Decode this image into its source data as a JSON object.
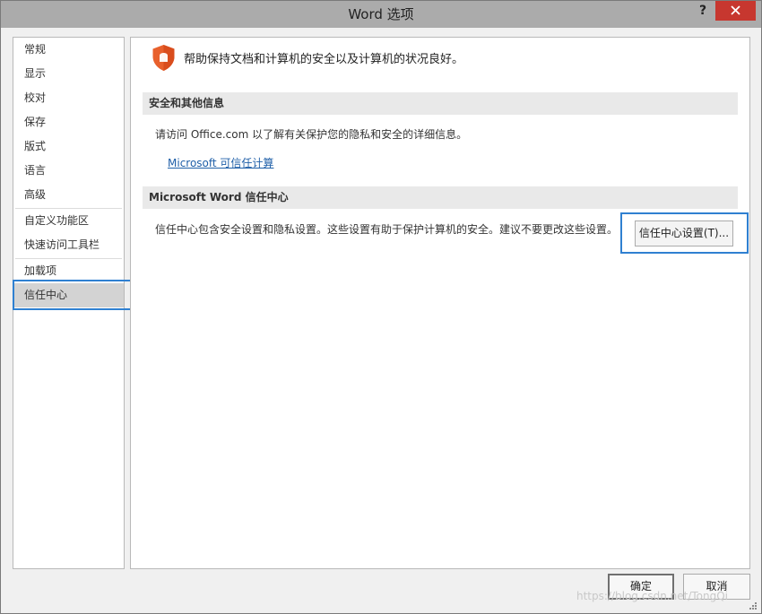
{
  "window": {
    "title": "Word 选项",
    "help_label": "?"
  },
  "nav": {
    "items": [
      {
        "label": "常规"
      },
      {
        "label": "显示"
      },
      {
        "label": "校对"
      },
      {
        "label": "保存"
      },
      {
        "label": "版式"
      },
      {
        "label": "语言"
      },
      {
        "label": "高级"
      },
      {
        "label": "自定义功能区"
      },
      {
        "label": "快速访问工具栏"
      },
      {
        "label": "加载项"
      },
      {
        "label": "信任中心"
      }
    ],
    "selected": "信任中心"
  },
  "content": {
    "intro": "帮助保持文档和计算机的安全以及计算机的状况良好。",
    "section1": {
      "header": "安全和其他信息",
      "text": "请访问 Office.com  以了解有关保护您的隐私和安全的详细信息。",
      "link": "Microsoft 可信任计算"
    },
    "section2": {
      "header": "Microsoft Word 信任中心",
      "text": "信任中心包含安全设置和隐私设置。这些设置有助于保护计算机的安全。建议不要更改这些设置。",
      "button": "信任中心设置(T)..."
    }
  },
  "footer": {
    "ok": "确定",
    "cancel": "取消"
  },
  "watermark": "https://blog.csdn.net/TongQi",
  "colors": {
    "accent_highlight": "#2f80d1",
    "shield": "#e8602c",
    "link": "#1f5fa8",
    "close": "#c7372f"
  }
}
